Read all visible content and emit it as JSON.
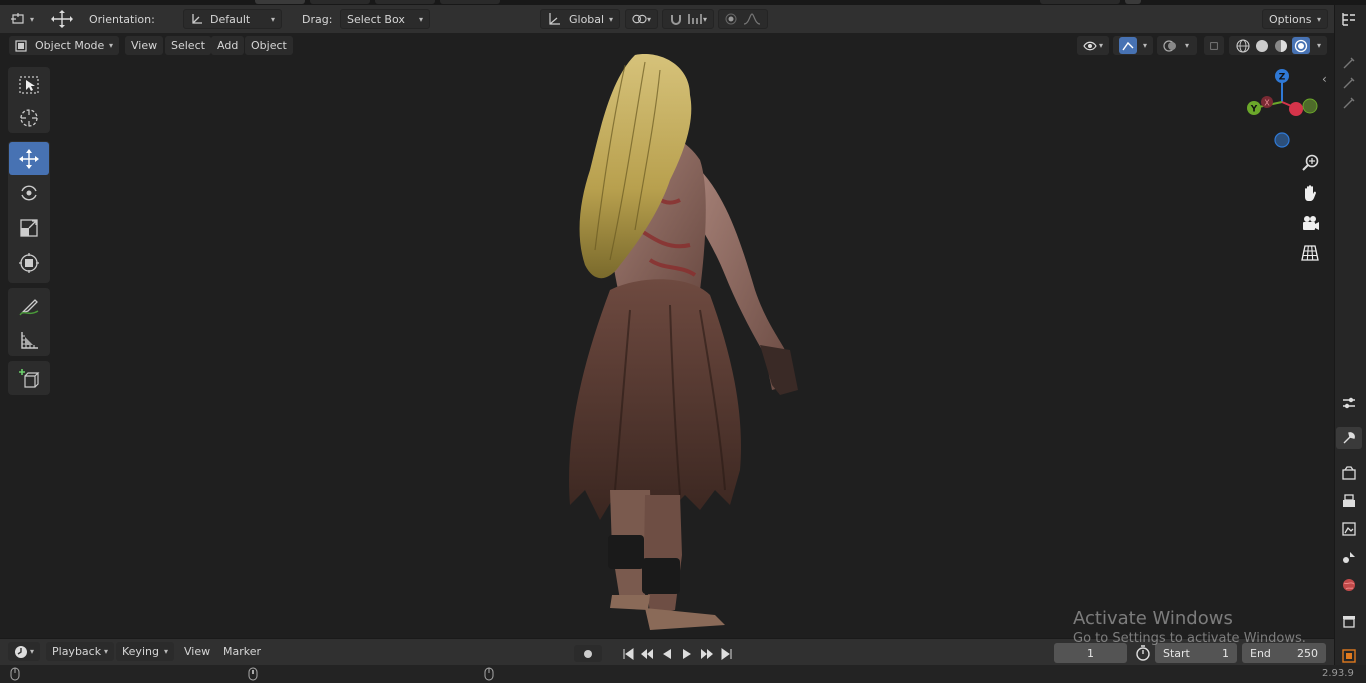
{
  "header": {
    "orientation_label": "Orientation:",
    "orientation_value": "Default",
    "drag_label": "Drag:",
    "drag_value": "Select Box",
    "transform_space": "Global",
    "options_label": "Options"
  },
  "viewport_menu": {
    "mode": "Object Mode",
    "view": "View",
    "select": "Select",
    "add": "Add",
    "object": "Object"
  },
  "gizmo": {
    "z": "Z",
    "y": "Y",
    "x": "X"
  },
  "timeline": {
    "playback": "Playback",
    "keying": "Keying",
    "view": "View",
    "marker": "Marker",
    "current_frame": "1",
    "start_label": "Start",
    "start_value": "1",
    "end_label": "End",
    "end_value": "250"
  },
  "status": {
    "version": "2.93.9"
  },
  "watermark": {
    "title": "Activate Windows",
    "subtitle": "Go to Settings to activate Windows."
  },
  "colors": {
    "accent": "#4772b3",
    "axis_x": "#d5344a",
    "axis_y": "#6ba82a",
    "axis_z": "#2f79d6"
  }
}
